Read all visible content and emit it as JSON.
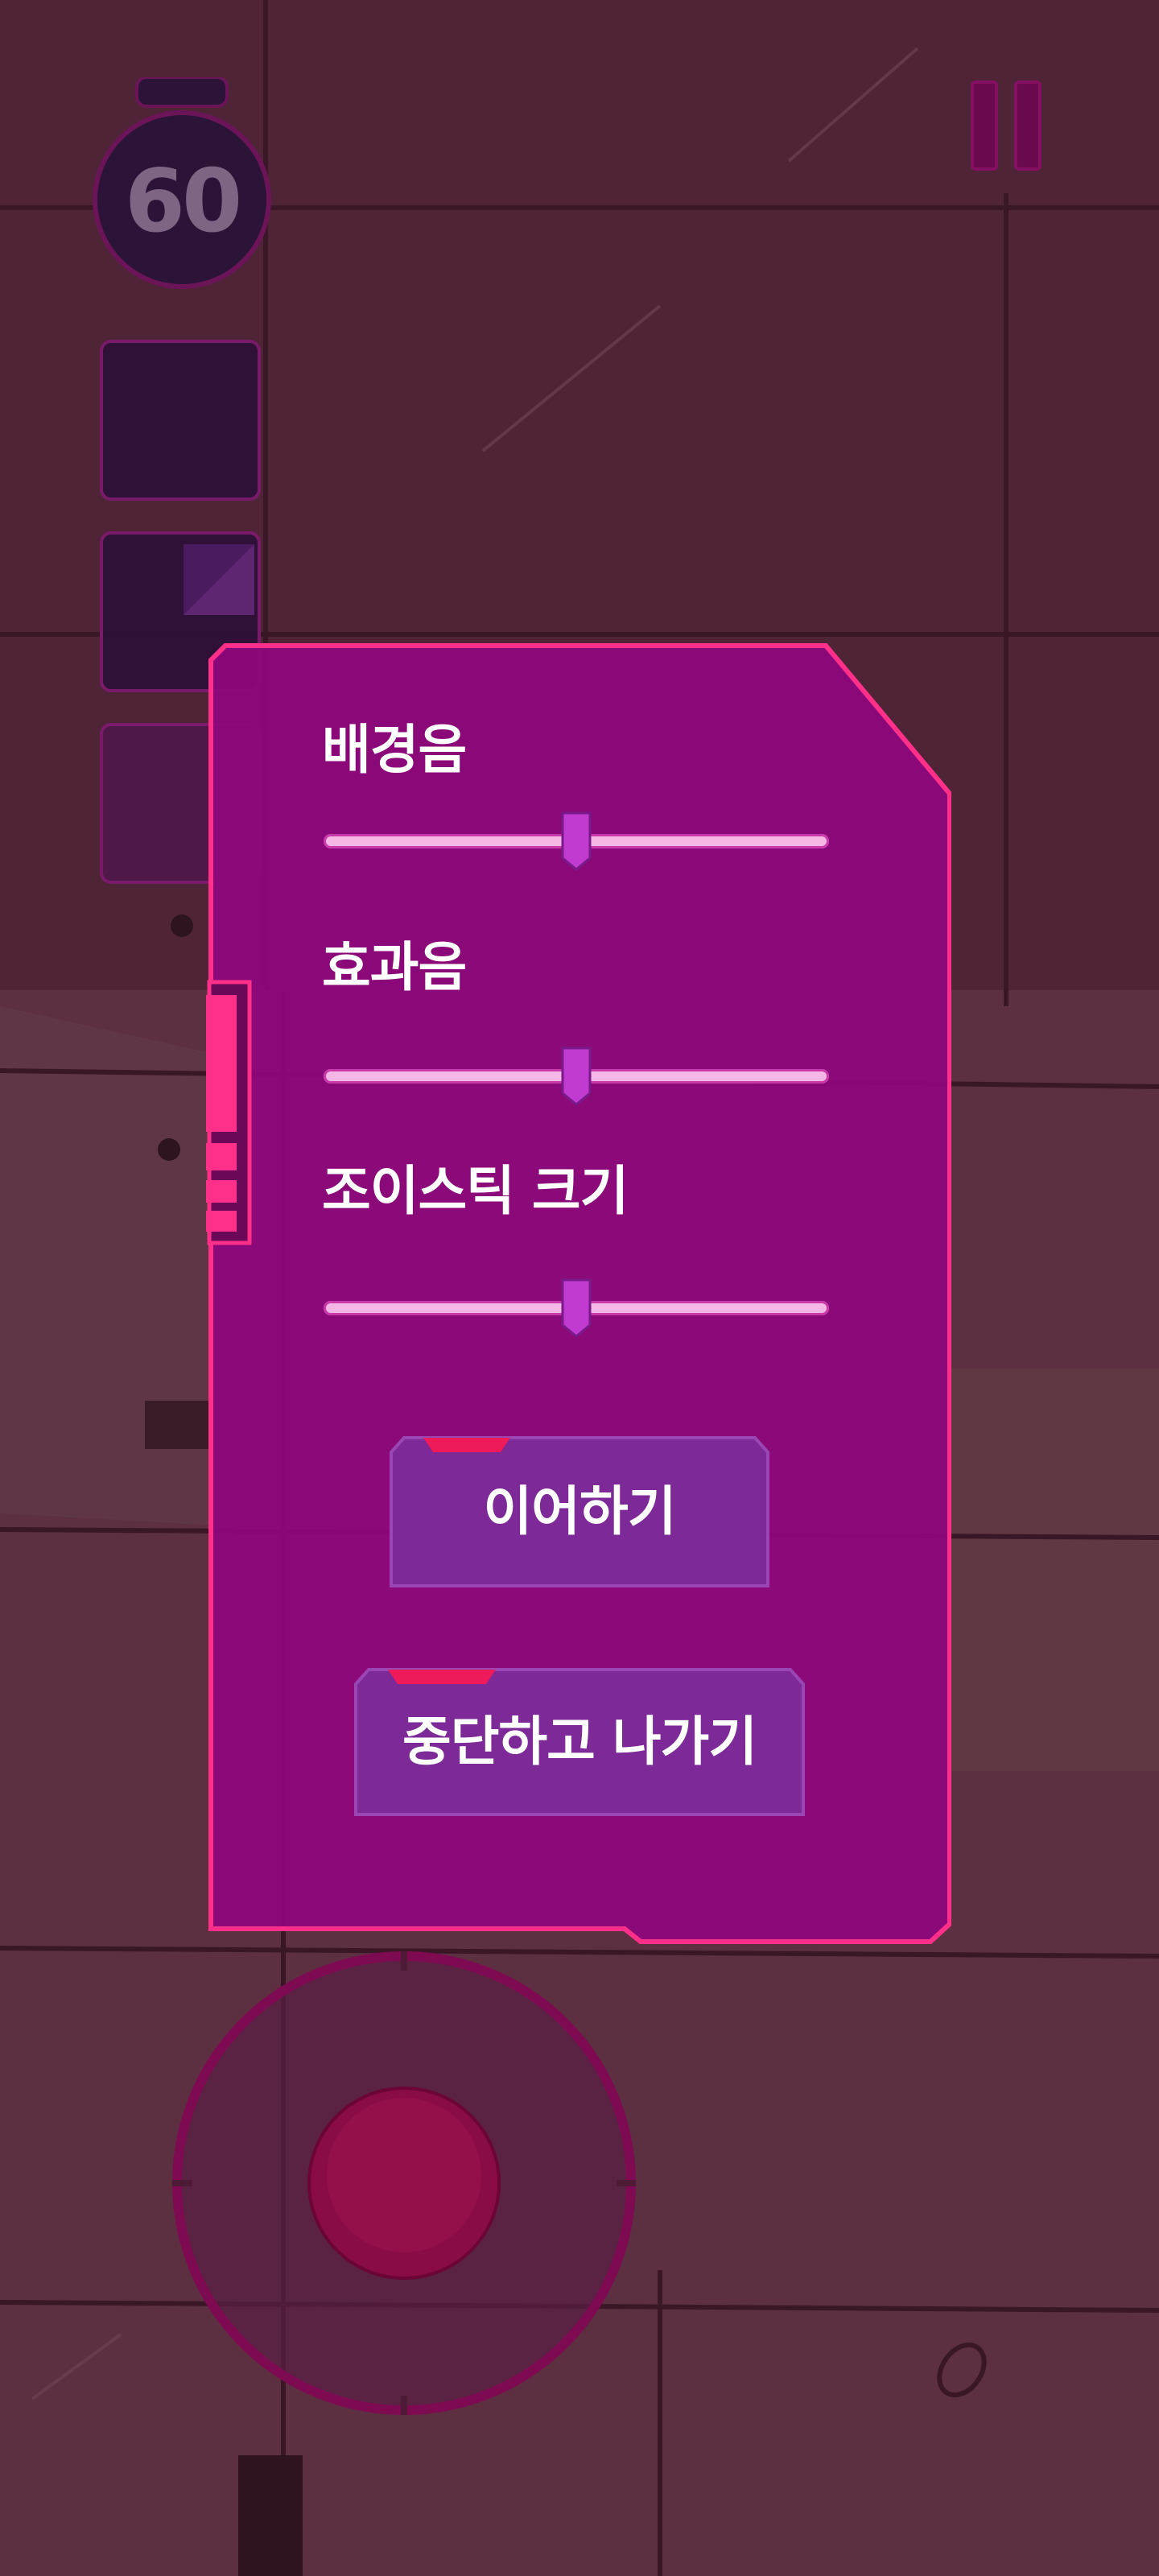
{
  "hud": {
    "timer_value": "60",
    "pause_icon": "pause-icon"
  },
  "settings": {
    "sliders": [
      {
        "label": "배경음",
        "value": 0.5
      },
      {
        "label": "효과음",
        "value": 0.5
      },
      {
        "label": "조이스틱 크기",
        "value": 0.5
      }
    ],
    "continue_label": "이어하기",
    "quit_label": "중단하고 나가기"
  },
  "colors": {
    "panel_fill": "#8e077c",
    "panel_border": "#ff2f8a",
    "slider_track": "#f5b8e6",
    "slider_thumb": "#c13bd1",
    "button_fill": "#7d2a98",
    "button_tab": "#ef1a5a",
    "joystick_knob": "#8a0c46"
  }
}
